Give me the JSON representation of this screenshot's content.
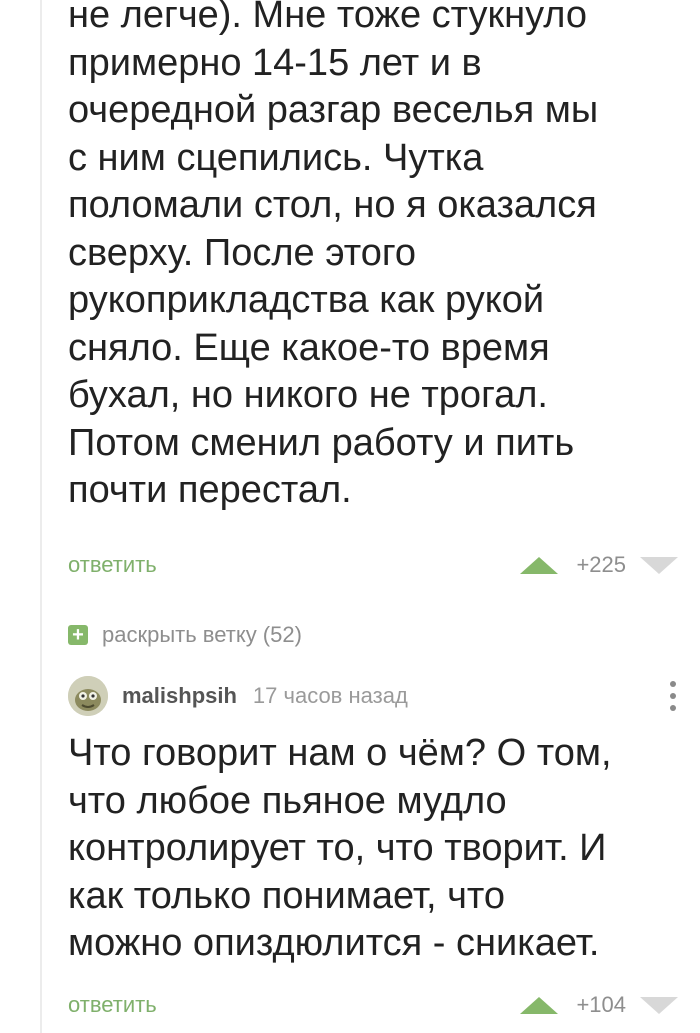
{
  "comments": [
    {
      "body": "не легче). Мне тоже стукнуло\nпримерно 14-15 лет и в\nочередной разгар веселья мы\nс ним сцепились. Чутка\nполомали стол, но я оказался\nсверху. После этого\nрукоприкладства как рукой\nсняло. Еще какое-то время\nбухал, но никого не трогал.\nПотом сменил работу и пить\nпочти перестал.",
      "reply_label": "ответить",
      "rating": "+225"
    },
    {
      "author": "malishpsih",
      "time": "17 часов назад",
      "body": "Что говорит нам о чём? О том,\nчто любое пьяное мудло\nконтролирует то, что творит. И\nкак только понимает, что\nможно опиздюлится - сникает.",
      "reply_label": "ответить",
      "rating": "+104"
    }
  ],
  "expand_thread": {
    "icon": "plus-icon",
    "label": "раскрыть ветку (52)"
  },
  "colors": {
    "accent": "#86b86a",
    "link": "#7fb06b",
    "muted": "#8e8e8e"
  }
}
